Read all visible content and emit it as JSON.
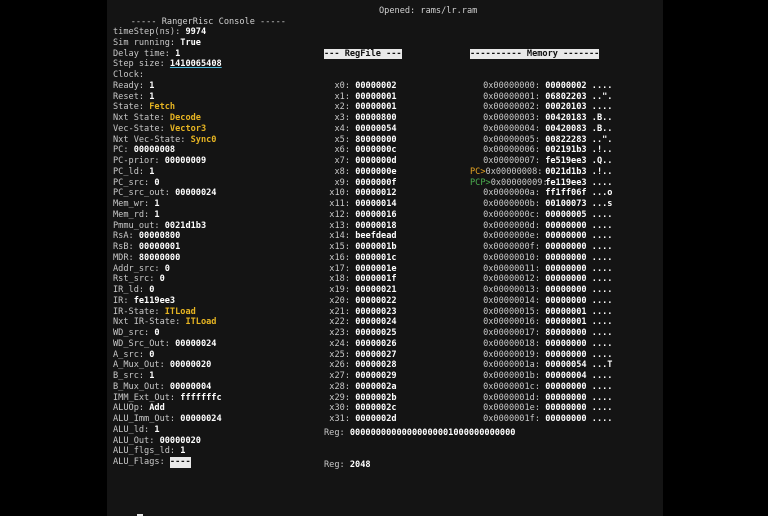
{
  "window": {
    "title": "----- RangerRisc Console -----",
    "opened": "Opened: rams/lr.ram"
  },
  "status": [
    {
      "label": "timeStep(ns): ",
      "value": "9974",
      "style": "val"
    },
    {
      "label": "Sim running: ",
      "value": "True",
      "style": "val"
    },
    {
      "label": "Delay time: ",
      "value": "1",
      "style": "val"
    },
    {
      "label": "Step size: ",
      "value": "1410065408",
      "style": "val"
    },
    {
      "label": "Clock: ",
      "value": "",
      "style": "val"
    },
    {
      "label": "Ready: ",
      "value": "1",
      "style": "val"
    },
    {
      "label": "Reset: ",
      "value": "1",
      "style": "val"
    },
    {
      "label": "State: ",
      "value": "Fetch",
      "style": "hl"
    },
    {
      "label": "Nxt State: ",
      "value": "Decode",
      "style": "hl"
    },
    {
      "label": "Vec-State: ",
      "value": "Vector3",
      "style": "hl"
    },
    {
      "label": "Nxt Vec-State: ",
      "value": "Sync0",
      "style": "hl"
    },
    {
      "label": "PC: ",
      "value": "00000008",
      "style": "val"
    },
    {
      "label": "PC-prior: ",
      "value": "00000009",
      "style": "val"
    },
    {
      "label": "PC_ld: ",
      "value": "1",
      "style": "val"
    },
    {
      "label": "PC_src: ",
      "value": "0",
      "style": "val"
    },
    {
      "label": "PC_src_out: ",
      "value": "00000024",
      "style": "val"
    },
    {
      "label": "Mem_wr: ",
      "value": "1",
      "style": "val"
    },
    {
      "label": "Mem_rd: ",
      "value": "1",
      "style": "val"
    },
    {
      "label": "Pmmu_out: ",
      "value": "0021d1b3",
      "style": "val"
    },
    {
      "label": "RsA: ",
      "value": "00000800",
      "style": "val"
    },
    {
      "label": "RsB: ",
      "value": "00000001",
      "style": "val"
    },
    {
      "label": "MDR: ",
      "value": "80000000",
      "style": "val"
    },
    {
      "label": "Addr_src: ",
      "value": "0",
      "style": "val"
    },
    {
      "label": "Rst_src: ",
      "value": "0",
      "style": "val"
    },
    {
      "label": "IR_ld: ",
      "value": "0",
      "style": "val"
    },
    {
      "label": "IR: ",
      "value": "fe119ee3",
      "style": "val"
    },
    {
      "label": "IR-State: ",
      "value": "ITLoad",
      "style": "hl"
    },
    {
      "label": "Nxt IR-State: ",
      "value": "ITLoad",
      "style": "hl"
    },
    {
      "label": "WD_src: ",
      "value": "0",
      "style": "val"
    },
    {
      "label": "WD_Src_Out: ",
      "value": "00000024",
      "style": "val"
    },
    {
      "label": "A_src: ",
      "value": "0",
      "style": "val"
    },
    {
      "label": "A_Mux_Out: ",
      "value": "00000020",
      "style": "val"
    },
    {
      "label": "B_src: ",
      "value": "1",
      "style": "val"
    },
    {
      "label": "B_Mux_Out: ",
      "value": "00000004",
      "style": "val"
    },
    {
      "label": "IMM_Ext_Out: ",
      "value": "fffffffc",
      "style": "val"
    },
    {
      "label": "ALUOp: ",
      "value": "Add",
      "style": "val"
    },
    {
      "label": "ALU_Imm_Out: ",
      "value": "00000024",
      "style": "val"
    },
    {
      "label": "ALU_ld: ",
      "value": "1",
      "style": "val"
    },
    {
      "label": "ALU_Out: ",
      "value": "00000020",
      "style": "val"
    },
    {
      "label": "ALU_flgs_ld: ",
      "value": "1",
      "style": "val"
    },
    {
      "label": "ALU_Flags: ",
      "value": "----",
      "style": "hdr"
    }
  ],
  "regfile": {
    "header": "--- RegFile ---",
    "rows": [
      {
        "name": "x0:",
        "value": "00000002"
      },
      {
        "name": "x1:",
        "value": "00000001"
      },
      {
        "name": "x2:",
        "value": "00000001"
      },
      {
        "name": "x3:",
        "value": "00000800"
      },
      {
        "name": "x4:",
        "value": "00000054"
      },
      {
        "name": "x5:",
        "value": "80000000"
      },
      {
        "name": "x6:",
        "value": "0000000c"
      },
      {
        "name": "x7:",
        "value": "0000000d"
      },
      {
        "name": "x8:",
        "value": "0000000e"
      },
      {
        "name": "x9:",
        "value": "0000000f"
      },
      {
        "name": "x10:",
        "value": "00000012"
      },
      {
        "name": "x11:",
        "value": "00000014"
      },
      {
        "name": "x12:",
        "value": "00000016"
      },
      {
        "name": "x13:",
        "value": "00000018"
      },
      {
        "name": "x14:",
        "value": "beefdead"
      },
      {
        "name": "x15:",
        "value": "0000001b"
      },
      {
        "name": "x16:",
        "value": "0000001c"
      },
      {
        "name": "x17:",
        "value": "0000001e"
      },
      {
        "name": "x18:",
        "value": "0000001f"
      },
      {
        "name": "x19:",
        "value": "00000021"
      },
      {
        "name": "x20:",
        "value": "00000022"
      },
      {
        "name": "x21:",
        "value": "00000023"
      },
      {
        "name": "x22:",
        "value": "00000024"
      },
      {
        "name": "x23:",
        "value": "00000025"
      },
      {
        "name": "x24:",
        "value": "00000026"
      },
      {
        "name": "x25:",
        "value": "00000027"
      },
      {
        "name": "x26:",
        "value": "00000028"
      },
      {
        "name": "x27:",
        "value": "00000029"
      },
      {
        "name": "x28:",
        "value": "0000002a"
      },
      {
        "name": "x29:",
        "value": "0000002b"
      },
      {
        "name": "x30:",
        "value": "0000002c"
      },
      {
        "name": "x31:",
        "value": "0000002d"
      }
    ]
  },
  "memory": {
    "header": "---------- Memory -------",
    "rows": [
      {
        "ptr": "",
        "addr": "0x00000000:",
        "value": "00000002",
        "ascii": "...."
      },
      {
        "ptr": "",
        "addr": "0x00000001:",
        "value": "06802203",
        "ascii": "..\"."
      },
      {
        "ptr": "",
        "addr": "0x00000002:",
        "value": "00020103",
        "ascii": "...."
      },
      {
        "ptr": "",
        "addr": "0x00000003:",
        "value": "00420183",
        "ascii": ".B.."
      },
      {
        "ptr": "",
        "addr": "0x00000004:",
        "value": "00420083",
        "ascii": ".B.."
      },
      {
        "ptr": "",
        "addr": "0x00000005:",
        "value": "00822283",
        "ascii": "..\"."
      },
      {
        "ptr": "",
        "addr": "0x00000006:",
        "value": "002191b3",
        "ascii": ".!.."
      },
      {
        "ptr": "",
        "addr": "0x00000007:",
        "value": "fe519ee3",
        "ascii": ".Q.."
      },
      {
        "ptr": "PC>",
        "ptrStyle": "ptr-pc",
        "addr": "0x00000008:",
        "value": "0021d1b3",
        "ascii": ".!.."
      },
      {
        "ptr": "PCP>",
        "ptrStyle": "ptr-pcp",
        "addr": "0x00000009:",
        "value": "fe119ee3",
        "ascii": "...."
      },
      {
        "ptr": "",
        "addr": "0x0000000a:",
        "value": "ff1ff06f",
        "ascii": "...o"
      },
      {
        "ptr": "",
        "addr": "0x0000000b:",
        "value": "00100073",
        "ascii": "...s"
      },
      {
        "ptr": "",
        "addr": "0x0000000c:",
        "value": "00000005",
        "ascii": "...."
      },
      {
        "ptr": "",
        "addr": "0x0000000d:",
        "value": "00000000",
        "ascii": "...."
      },
      {
        "ptr": "",
        "addr": "0x0000000e:",
        "value": "00000000",
        "ascii": "...."
      },
      {
        "ptr": "",
        "addr": "0x0000000f:",
        "value": "00000000",
        "ascii": "...."
      },
      {
        "ptr": "",
        "addr": "0x00000010:",
        "value": "00000000",
        "ascii": "...."
      },
      {
        "ptr": "",
        "addr": "0x00000011:",
        "value": "00000000",
        "ascii": "...."
      },
      {
        "ptr": "",
        "addr": "0x00000012:",
        "value": "00000000",
        "ascii": "...."
      },
      {
        "ptr": "",
        "addr": "0x00000013:",
        "value": "00000000",
        "ascii": "...."
      },
      {
        "ptr": "",
        "addr": "0x00000014:",
        "value": "00000000",
        "ascii": "...."
      },
      {
        "ptr": "",
        "addr": "0x00000015:",
        "value": "00000001",
        "ascii": "...."
      },
      {
        "ptr": "",
        "addr": "0x00000016:",
        "value": "00000001",
        "ascii": "...."
      },
      {
        "ptr": "",
        "addr": "0x00000017:",
        "value": "80000000",
        "ascii": "...."
      },
      {
        "ptr": "",
        "addr": "0x00000018:",
        "value": "00000000",
        "ascii": "...."
      },
      {
        "ptr": "",
        "addr": "0x00000019:",
        "value": "00000000",
        "ascii": "...."
      },
      {
        "ptr": "",
        "addr": "0x0000001a:",
        "value": "00000054",
        "ascii": "...T"
      },
      {
        "ptr": "",
        "addr": "0x0000001b:",
        "value": "00000004",
        "ascii": "...."
      },
      {
        "ptr": "",
        "addr": "0x0000001c:",
        "value": "00000000",
        "ascii": "...."
      },
      {
        "ptr": "",
        "addr": "0x0000001d:",
        "value": "00000000",
        "ascii": "...."
      },
      {
        "ptr": "",
        "addr": "0x0000001e:",
        "value": "00000000",
        "ascii": "...."
      },
      {
        "ptr": "",
        "addr": "0x0000001f:",
        "value": "00000000",
        "ascii": "...."
      }
    ]
  },
  "regline": {
    "reg1_label": "Reg: ",
    "reg1_value": "00000000000000000001000000000000",
    "reg2_label": "Reg: ",
    "reg2_value": "2048"
  },
  "prompt": {
    "text": ">"
  }
}
